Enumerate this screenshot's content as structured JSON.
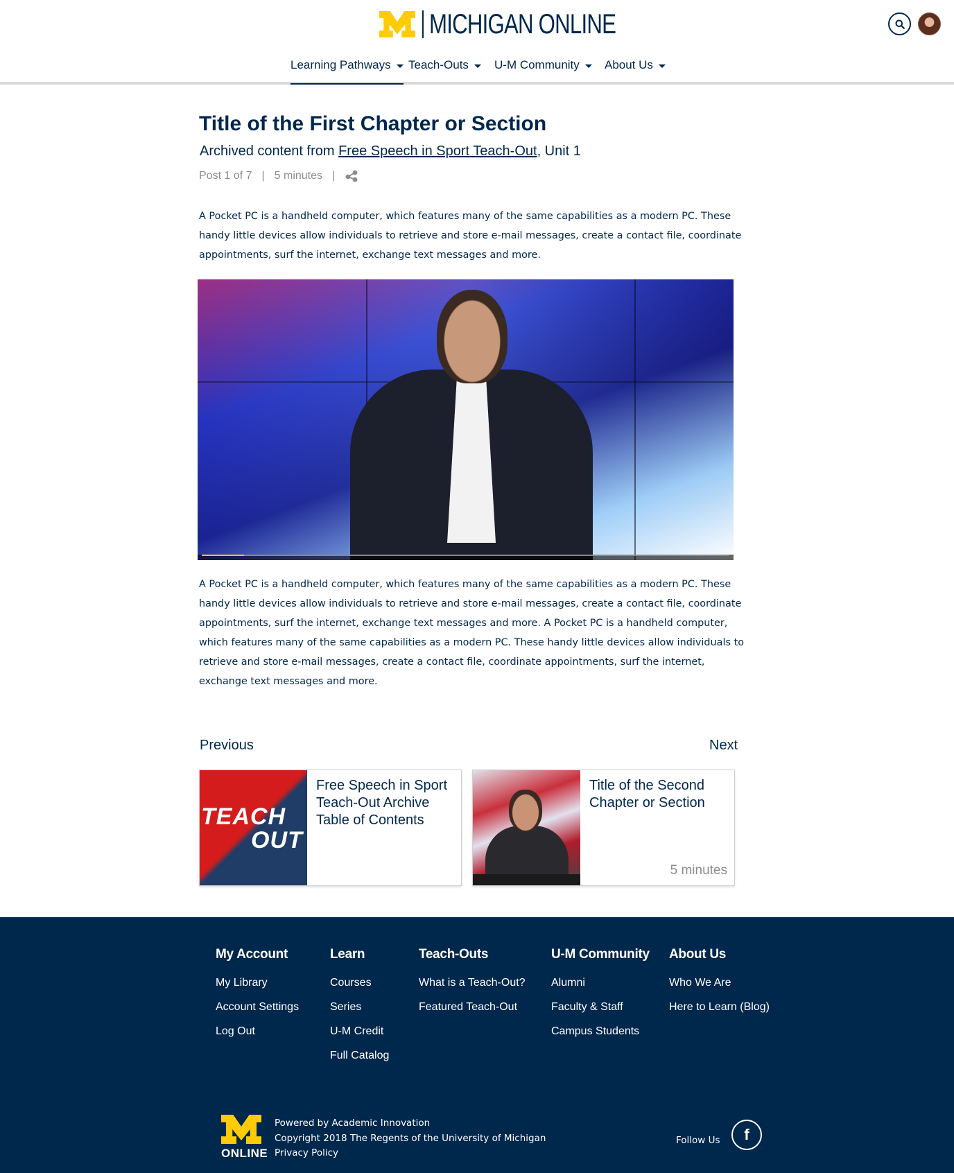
{
  "header": {
    "brand_name": "MICHIGAN ONLINE",
    "search_icon": "search-icon",
    "avatar_icon": "user-avatar"
  },
  "nav": {
    "items": [
      {
        "label": "Learning Pathways"
      },
      {
        "label": "Teach-Outs"
      },
      {
        "label": "U-M Community"
      },
      {
        "label": "About Us"
      }
    ]
  },
  "article": {
    "title": "Title of the First Chapter or Section",
    "subtitle_prefix": "Archived content from ",
    "subtitle_link": "Free Speech in Sport Teach-Out",
    "subtitle_suffix": ", Unit 1",
    "post_position": "Post 1 of 7",
    "sep": "|",
    "duration": "5 minutes",
    "share_icon": "share-icon",
    "paragraph1": "A Pocket PC is a handheld computer, which features many of the same capabilities as a modern PC. These handy little devices allow individuals to retrieve and store e-mail messages, create a contact file, coordinate appointments, surf the internet, exchange text messages and more.",
    "paragraph2": "A Pocket PC is a handheld computer, which features many of the same capabilities as a modern PC. These handy little devices allow individuals to retrieve and store e-mail messages, create a contact file, coordinate appointments, surf the internet, exchange text messages and more. A Pocket PC is a handheld computer, which features many of the same capabilities as a modern PC. These handy little devices allow individuals to retrieve and store e-mail messages, create a contact file, coordinate appointments, surf the internet, exchange text messages and more.",
    "video_progress": 0.08
  },
  "pagination": {
    "previous_label": "Previous",
    "next_label": "Next",
    "previous_card": {
      "title": "Free Speech in Sport Teach-Out Archive Table of Contents",
      "thumb_text_1": "TEACH",
      "thumb_text_2": "OUT"
    },
    "next_card": {
      "title": "Title of the Second Chapter or Section",
      "duration": "5 minutes"
    }
  },
  "footer": {
    "columns": [
      {
        "heading": "My Account",
        "links": [
          "My Library",
          "Account Settings",
          "Log Out"
        ]
      },
      {
        "heading": "Learn",
        "links": [
          "Courses",
          "Series",
          "U-M Credit",
          "Full Catalog"
        ]
      },
      {
        "heading": "Teach-Outs",
        "links": [
          "What is a Teach-Out?",
          "Featured Teach-Out"
        ]
      },
      {
        "heading": "U-M Community",
        "links": [
          "Alumni",
          "Faculty & Staff",
          "Campus Students"
        ]
      },
      {
        "heading": "About Us",
        "links": [
          "Who We Are",
          "Here to Learn (Blog)"
        ]
      }
    ],
    "logo_word": "ONLINE",
    "powered_by": "Powered by Academic Innovation",
    "copyright": "Copyright 2018 The Regents of the University of Michigan",
    "privacy": "Privacy Policy",
    "follow_us": "Follow Us",
    "facebook_icon": "facebook-icon",
    "facebook_glyph": "f"
  },
  "colors": {
    "navy": "#00274c",
    "maize": "#ffcb05",
    "muted": "#8c8c8c"
  }
}
